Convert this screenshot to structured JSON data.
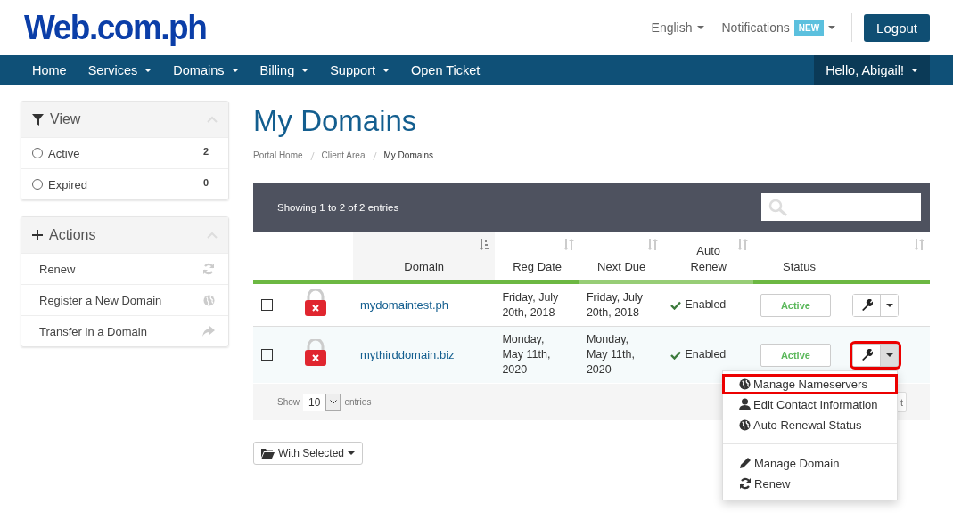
{
  "header": {
    "logo": "Web.com.ph",
    "language": "English",
    "notifications": {
      "label": "Notifications",
      "badge": "NEW"
    },
    "logout": "Logout"
  },
  "nav": {
    "items": [
      {
        "label": "Home",
        "dropdown": false
      },
      {
        "label": "Services",
        "dropdown": true
      },
      {
        "label": "Domains",
        "dropdown": true
      },
      {
        "label": "Billing",
        "dropdown": true
      },
      {
        "label": "Support",
        "dropdown": true
      },
      {
        "label": "Open Ticket",
        "dropdown": false
      }
    ],
    "account": "Hello, Abigail!"
  },
  "sidebar": {
    "panels": [
      {
        "kind": "filter",
        "title": "View",
        "items": [
          {
            "label": "Active",
            "count": "2",
            "selected": false
          },
          {
            "label": "Expired",
            "count": "0",
            "selected": false
          }
        ]
      },
      {
        "kind": "actions",
        "title": "Actions",
        "items": [
          {
            "label": "Renew"
          },
          {
            "label": "Register a New Domain"
          },
          {
            "label": "Transfer in a Domain"
          }
        ]
      }
    ]
  },
  "page": {
    "title": "My Domains",
    "breadcrumb": [
      {
        "label": "Portal Home",
        "current": false
      },
      {
        "label": "Client Area",
        "current": false
      },
      {
        "label": "My Domains",
        "current": true
      }
    ]
  },
  "table": {
    "info": "Showing 1 to 2 of 2 entries",
    "columns": [
      {
        "kind": "select"
      },
      {
        "kind": "lock"
      },
      {
        "kind": "text",
        "label": "Domain",
        "sortable": true,
        "sorted": true
      },
      {
        "kind": "text",
        "label": "Reg Date",
        "sortable": true,
        "sorted": false
      },
      {
        "kind": "text",
        "label": "Next Due",
        "sortable": true,
        "sorted": false
      },
      {
        "kind": "text",
        "label": "Auto Renew",
        "sortable": true,
        "sorted": false
      },
      {
        "kind": "text",
        "label": "Status",
        "sortable": false
      },
      {
        "kind": "actions",
        "sortable": true,
        "sorted": false
      }
    ],
    "rows": [
      {
        "checked": false,
        "domain": "mydomaintest.ph",
        "reg_date": "Friday, July 20th, 2018",
        "next_due": "Friday, July 20th, 2018",
        "auto_renew": "Enabled",
        "status": "Active",
        "menu_open": false,
        "highlighted": false
      },
      {
        "checked": false,
        "domain": "mythirddomain.biz",
        "reg_date": "Monday, May 11th, 2020",
        "next_due": "Monday, May 11th, 2020",
        "auto_renew": "Enabled",
        "status": "Active",
        "menu_open": true,
        "highlighted": true
      }
    ],
    "menu": [
      {
        "kind": "item",
        "label": "Manage Nameservers",
        "highlighted": true
      },
      {
        "kind": "item",
        "label": "Edit Contact Information",
        "highlighted": false
      },
      {
        "kind": "item",
        "label": "Auto Renewal Status",
        "highlighted": false
      },
      {
        "kind": "divider"
      },
      {
        "kind": "item",
        "label": "Manage Domain",
        "highlighted": false
      },
      {
        "kind": "item",
        "label": "Renew",
        "highlighted": false
      }
    ],
    "footer": {
      "show_label": "Show",
      "page_size": "10",
      "entries_label": "entries",
      "pager": "t"
    }
  },
  "bulk_button": "With Selected"
}
